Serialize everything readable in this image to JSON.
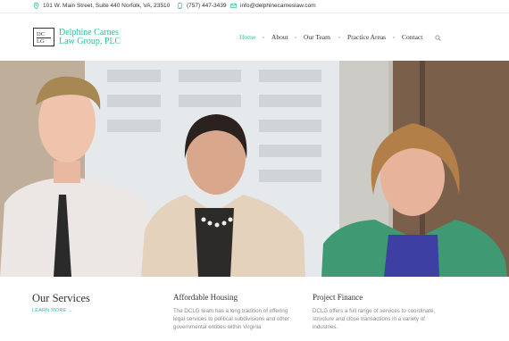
{
  "topbar": {
    "address": "101 W. Main Street, Suite 440 Norfolk, VA, 23510",
    "phone": "(757) 447-3439",
    "email": "info@delphinecarneslaw.com"
  },
  "logo": {
    "mark_top": "DC",
    "mark_bottom": "LG",
    "line1": "Delphine Carnes",
    "line2": "Law Group, PLC"
  },
  "nav": {
    "items": [
      "Home",
      "About",
      "Our Team",
      "Practice Areas",
      "Contact"
    ],
    "active": "Home"
  },
  "hero": {
    "image_alt": "Three attorneys standing in front of a window"
  },
  "services": {
    "title": "Our Services",
    "learn_more": "LEARN MORE →",
    "columns": [
      {
        "heading": "Affordable Housing",
        "text": "The DCLG team has a long tradition of offering legal services to political subdivisions and other governmental entities within Virginia"
      },
      {
        "heading": "Project Finance",
        "text": "DCLG offers a full range of services to coordinate, structure and close transactions in a variety of industries."
      }
    ]
  },
  "colors": {
    "accent": "#2fbf9e",
    "text": "#333333",
    "muted": "#888888"
  }
}
